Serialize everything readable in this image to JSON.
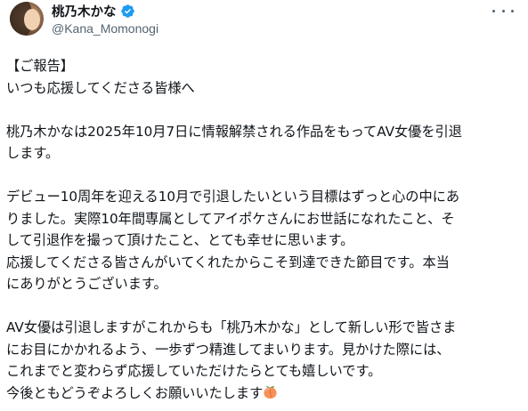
{
  "author": {
    "display_name": "桃乃木かな",
    "handle": "@Kana_Momonogi",
    "verified_icon": "verified-badge-icon",
    "badge_color": "#1d9bf0"
  },
  "menu": {
    "icon": "more-options-icon"
  },
  "tweet": {
    "paragraphs": [
      [
        "【ご報告】",
        "いつも応援してくださる皆様へ"
      ],
      [
        "桃乃木かなは2025年10月7日に情報解禁される作品をもってAV女優を引退",
        "します。"
      ],
      [
        "デビュー10周年を迎える10月で引退したいという目標はずっと心の中にあ",
        "りました。実際10年間専属としてアイポケさんにお世話になれたこと、そ",
        "して引退作を撮って頂けたこと、とても幸せに思います。",
        "応援してくださる皆さんがいてくれたからこそ到達できた節目です。本当",
        "にありがとうございます。"
      ],
      [
        "AV女優は引退しますがこれからも「桃乃木かな」として新しい形で皆さま",
        "にお目にかかれるよう、一歩ずつ精進してまいります。見かけた際には、",
        "これまでと変わらず応援していただけたらとても嬉しいです。",
        "今後ともどうぞよろしくお願いいたします"
      ]
    ],
    "emoji_icon": "peach-emoji-icon"
  }
}
